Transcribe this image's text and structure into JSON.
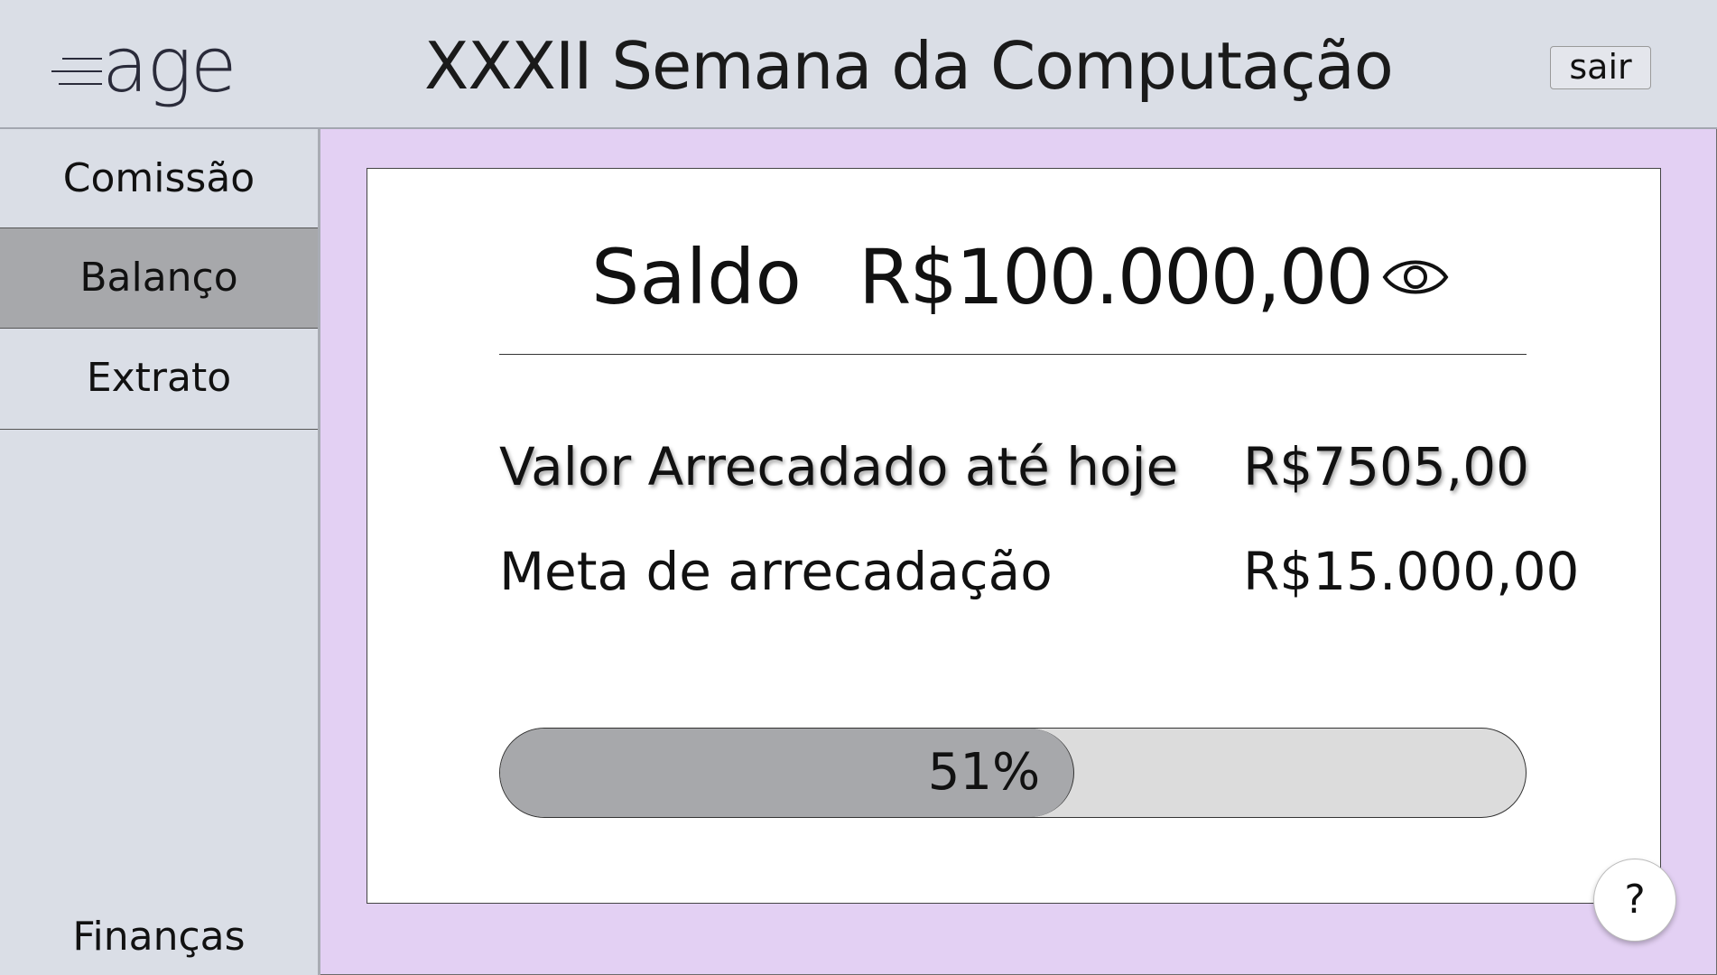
{
  "header": {
    "logo_text": "age",
    "title": "XXXII Semana da Computação",
    "logout_label": "sair"
  },
  "sidebar": {
    "items": [
      {
        "label": "Comissão",
        "active": false
      },
      {
        "label": "Balanço",
        "active": true
      },
      {
        "label": "Extrato",
        "active": false
      }
    ],
    "footer_label": "Finanças"
  },
  "balance": {
    "label": "Saldo",
    "value": "R$100.000,00",
    "toggle_icon": "eye-icon"
  },
  "stats": {
    "raised_label": "Valor Arrecadado até hoje",
    "raised_value": "R$7505,00",
    "goal_label": "Meta de arrecadação",
    "goal_value": "R$15.000,00"
  },
  "progress": {
    "percent": 51,
    "label": "51%"
  },
  "help": {
    "label": "?"
  },
  "colors": {
    "background_accent": "#e3d0f3",
    "header_bg": "#dadee6",
    "active_item_bg": "#a7a8ab",
    "progress_track": "#dcdcdc",
    "progress_fill": "#a7a8ab"
  }
}
